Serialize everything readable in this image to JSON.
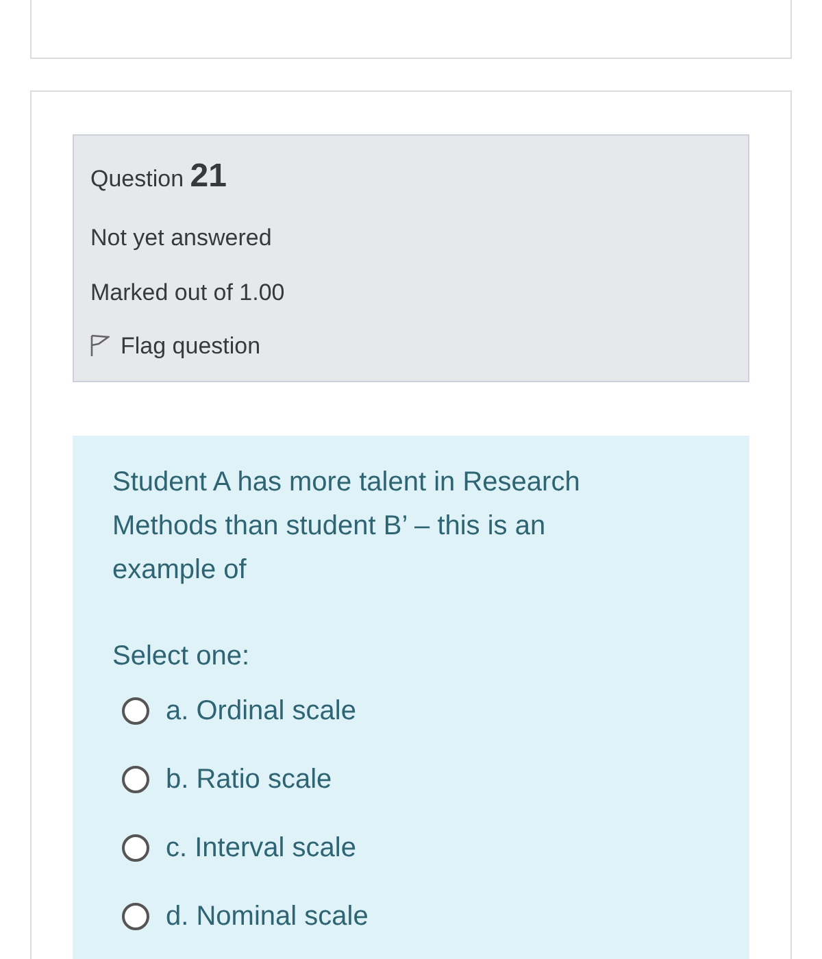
{
  "info": {
    "label": "Question",
    "number": "21",
    "state": "Not yet answered",
    "marks": "Marked out of 1.00",
    "flag": {
      "label": "Flag question",
      "flagged": false
    }
  },
  "question": {
    "text": "Student A has more talent in Research Methods than student B’ – this is an example of",
    "prompt": "Select one:",
    "options": [
      {
        "label": "a. Ordinal scale",
        "selected": false
      },
      {
        "label": "b. Ratio scale",
        "selected": false
      },
      {
        "label": "c. Interval scale",
        "selected": false
      },
      {
        "label": "d. Nominal scale",
        "selected": false
      }
    ]
  }
}
